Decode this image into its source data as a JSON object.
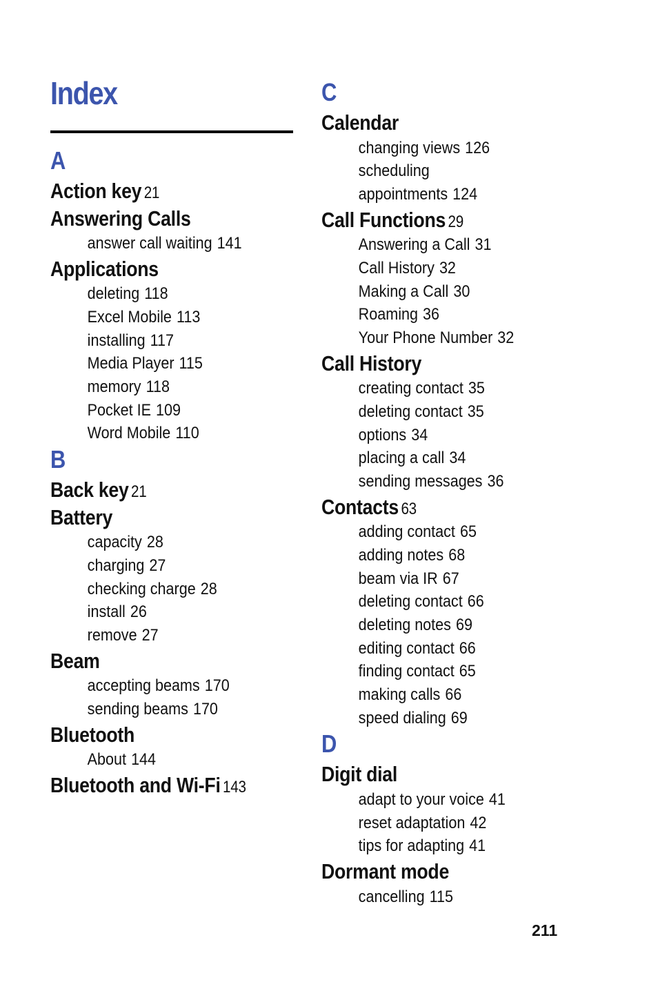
{
  "page": {
    "title": "Index",
    "page_number": "211",
    "accent_color": "#3c55ad"
  },
  "left_column": [
    {
      "letter": "A",
      "entries": [
        {
          "term": "Action key",
          "page": "21",
          "subs": []
        },
        {
          "term": "Answering Calls",
          "page": "",
          "subs": [
            {
              "text": "answer call waiting",
              "page": "141"
            }
          ]
        },
        {
          "term": "Applications",
          "page": "",
          "subs": [
            {
              "text": "deleting",
              "page": "118"
            },
            {
              "text": "Excel Mobile",
              "page": "113"
            },
            {
              "text": "installing",
              "page": "117"
            },
            {
              "text": "Media Player",
              "page": "115"
            },
            {
              "text": "memory",
              "page": "118"
            },
            {
              "text": "Pocket IE",
              "page": "109"
            },
            {
              "text": "Word Mobile",
              "page": "110"
            }
          ]
        }
      ]
    },
    {
      "letter": "B",
      "entries": [
        {
          "term": "Back key",
          "page": "21",
          "subs": []
        },
        {
          "term": "Battery",
          "page": "",
          "subs": [
            {
              "text": "capacity",
              "page": "28"
            },
            {
              "text": "charging",
              "page": "27"
            },
            {
              "text": "checking charge",
              "page": "28"
            },
            {
              "text": "install",
              "page": "26"
            },
            {
              "text": "remove",
              "page": "27"
            }
          ]
        },
        {
          "term": "Beam",
          "page": "",
          "subs": [
            {
              "text": "accepting beams",
              "page": "170"
            },
            {
              "text": "sending beams",
              "page": "170"
            }
          ]
        },
        {
          "term": "Bluetooth",
          "page": "",
          "subs": [
            {
              "text": "About",
              "page": "144"
            }
          ]
        },
        {
          "term": "Bluetooth and Wi-Fi",
          "page": "143",
          "subs": []
        }
      ]
    }
  ],
  "right_column": [
    {
      "letter": "C",
      "entries": [
        {
          "term": "Calendar",
          "page": "",
          "subs": [
            {
              "text": "changing views",
              "page": "126"
            },
            {
              "text": "scheduling",
              "page": ""
            },
            {
              "text": "appointments",
              "page": "124"
            }
          ]
        },
        {
          "term": "Call Functions",
          "page": "29",
          "subs": [
            {
              "text": "Answering a Call",
              "page": "31"
            },
            {
              "text": "Call History",
              "page": "32"
            },
            {
              "text": "Making a Call",
              "page": "30"
            },
            {
              "text": "Roaming",
              "page": "36"
            },
            {
              "text": "Your Phone Number",
              "page": "32"
            }
          ]
        },
        {
          "term": "Call History",
          "page": "",
          "subs": [
            {
              "text": "creating contact",
              "page": "35"
            },
            {
              "text": "deleting contact",
              "page": "35"
            },
            {
              "text": "options",
              "page": "34"
            },
            {
              "text": "placing a call",
              "page": "34"
            },
            {
              "text": "sending messages",
              "page": "36"
            }
          ]
        },
        {
          "term": "Contacts",
          "page": "63",
          "subs": [
            {
              "text": "adding contact",
              "page": "65"
            },
            {
              "text": "adding notes",
              "page": "68"
            },
            {
              "text": "beam via IR",
              "page": "67"
            },
            {
              "text": "deleting contact",
              "page": "66"
            },
            {
              "text": "deleting notes",
              "page": "69"
            },
            {
              "text": "editing contact",
              "page": "66"
            },
            {
              "text": "finding contact",
              "page": "65"
            },
            {
              "text": "making calls",
              "page": "66"
            },
            {
              "text": "speed dialing",
              "page": "69"
            }
          ]
        }
      ]
    },
    {
      "letter": "D",
      "entries": [
        {
          "term": "Digit dial",
          "page": "",
          "subs": [
            {
              "text": "adapt to your voice",
              "page": "41"
            },
            {
              "text": "reset adaptation",
              "page": "42"
            },
            {
              "text": "tips for adapting",
              "page": "41"
            }
          ]
        },
        {
          "term": "Dormant mode",
          "page": "",
          "subs": [
            {
              "text": "cancelling",
              "page": "115"
            }
          ]
        }
      ]
    }
  ]
}
